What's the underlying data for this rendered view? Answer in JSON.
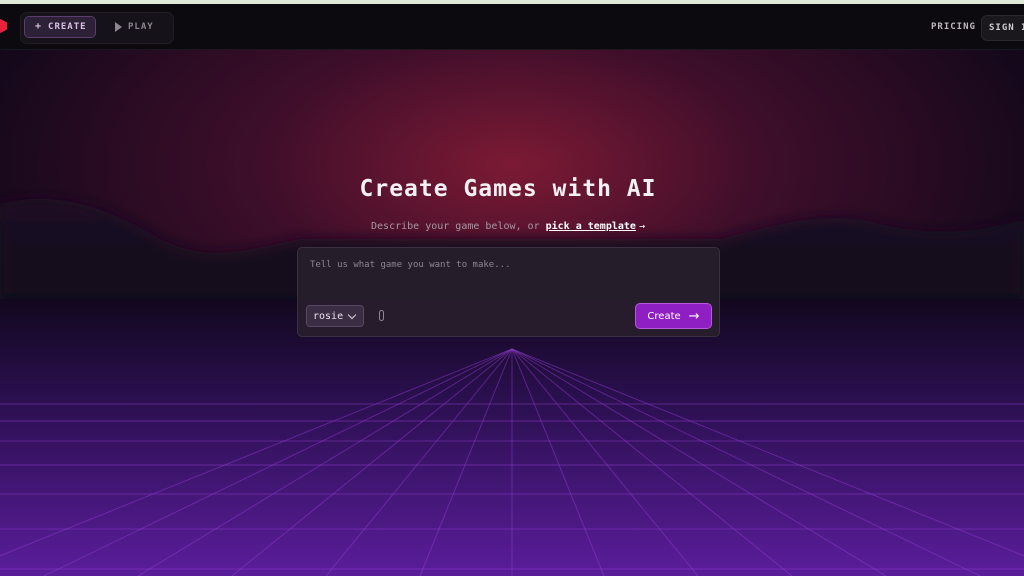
{
  "nav": {
    "tabs": [
      {
        "label": "CREATE",
        "icon": "plus-icon",
        "active": true
      },
      {
        "label": "PLAY",
        "icon": "play-icon",
        "active": false
      }
    ],
    "pricing_label": "PRICING",
    "signin_label": "SIGN IN"
  },
  "hero": {
    "title": "Create Games with AI",
    "subtitle_prefix": "Describe your game below, or",
    "template_link": "pick a template"
  },
  "prompt": {
    "placeholder": "Tell us what game you want to make...",
    "value": "",
    "model": "rosie",
    "create_label": "Create"
  },
  "colors": {
    "accent": "#8f1fc2",
    "logo": "#e8223a",
    "grid": "#9a3fd6",
    "glow": "#8a1838"
  }
}
